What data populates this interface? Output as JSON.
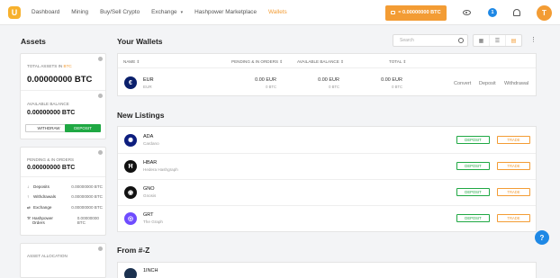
{
  "nav": {
    "logo": "U",
    "items": [
      {
        "label": "Dashboard",
        "active": false
      },
      {
        "label": "Mining",
        "active": false
      },
      {
        "label": "Buy/Sell Crypto",
        "active": false
      },
      {
        "label": "Exchange",
        "active": false,
        "caret": "▾"
      },
      {
        "label": "Hashpower Marketplace",
        "active": false
      },
      {
        "label": "Wallets",
        "active": true
      }
    ],
    "balance": "≈ 0.00000000 BTC",
    "notification_count": "1",
    "avatar_initial": "T"
  },
  "assets": {
    "title": "Assets",
    "total_label": "TOTAL ASSETS IN",
    "total_currency": "BTC",
    "total_value": "0.00000000 BTC",
    "available_label": "AVAILABLE BALANCE",
    "available_value": "0.00000000 BTC",
    "withdraw_label": "WITHDRAW",
    "deposit_label": "DEPOSIT",
    "pending_label": "PENDING & IN ORDERS",
    "pending_value": "0.00000000 BTC",
    "pending_rows": [
      {
        "icon": "↓",
        "name": "Deposits",
        "value": "0.00000000 BTC"
      },
      {
        "icon": "↑",
        "name": "Withdrawals",
        "value": "0.00000000 BTC"
      },
      {
        "icon": "⇄",
        "name": "Exchange",
        "value": "0.00000000 BTC"
      },
      {
        "icon": "⚒",
        "name": "Hashpower Orders",
        "value": "0.00000000 BTC"
      }
    ],
    "allocation_label": "ASSET ALLOCATION"
  },
  "wallets": {
    "title": "Your Wallets",
    "search_placeholder": "Search",
    "view_icons": [
      "▦",
      "☰",
      "▤"
    ],
    "kebab": "⋮",
    "columns": [
      "NAME ⇕",
      "PENDING & IN ORDERS ⇕",
      "AVAILABLE BALANCE ⇕",
      "TOTAL ⇕"
    ],
    "rows": [
      {
        "symbol": "EUR",
        "name": "EUR",
        "icon_glyph": "€",
        "icon_color": "#0a1f6b",
        "pending": "0.00 EUR",
        "pending_btc": "0 BTC",
        "available": "0.00 EUR",
        "available_btc": "0 BTC",
        "total": "0.00 EUR",
        "total_btc": "0 BTC",
        "actions": [
          "Convert",
          "Deposit",
          "Withdrawal"
        ]
      }
    ]
  },
  "new_listings": {
    "title": "New Listings",
    "deposit_label": "DEPOSIT",
    "trade_label": "TRADE",
    "rows": [
      {
        "symbol": "ADA",
        "name": "Cardano",
        "icon_glyph": "✺",
        "icon_color": "#0d1e7e"
      },
      {
        "symbol": "HBAR",
        "name": "Hedera Hashgraph",
        "icon_glyph": "Ħ",
        "icon_color": "#111111"
      },
      {
        "symbol": "GNO",
        "name": "Gnosis",
        "icon_glyph": "◉",
        "icon_color": "#111111"
      },
      {
        "symbol": "GRT",
        "name": "The Graph",
        "icon_glyph": "◎",
        "icon_color": "#6f4cff"
      }
    ]
  },
  "from_az": {
    "title": "From #-Z",
    "rows": [
      {
        "symbol": "1INCH",
        "name": "",
        "icon_color": "#1b314f"
      }
    ]
  },
  "help": "?"
}
